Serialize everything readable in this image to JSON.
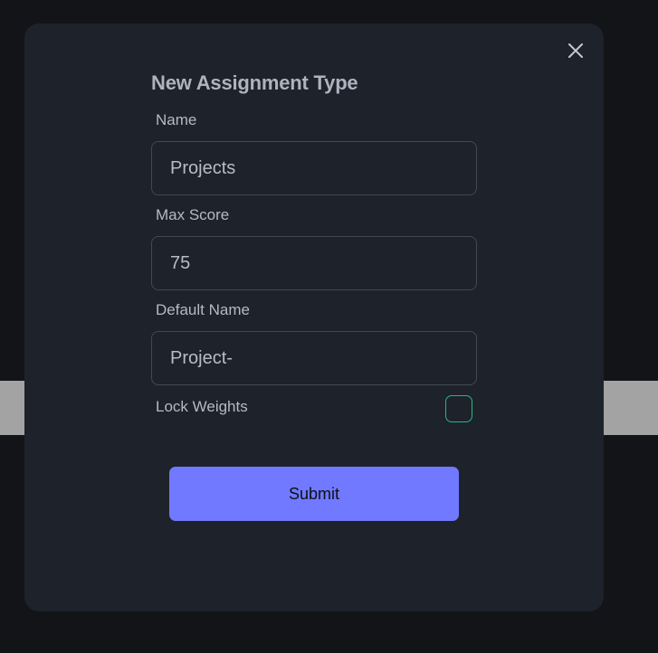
{
  "modal": {
    "title": "New Assignment Type",
    "fields": [
      {
        "label": "Name",
        "value": "Projects"
      },
      {
        "label": "Max Score",
        "value": "75"
      },
      {
        "label": "Default Name",
        "value": "Project-"
      }
    ],
    "lock_weights": {
      "label": "Lock Weights",
      "checked": false
    },
    "submit_label": "Submit",
    "close_icon": "close-icon"
  },
  "colors": {
    "page_background": "#121418",
    "modal_background": "#1e222a",
    "accent": "#7079ff",
    "checkbox_border": "#1fb98a"
  }
}
